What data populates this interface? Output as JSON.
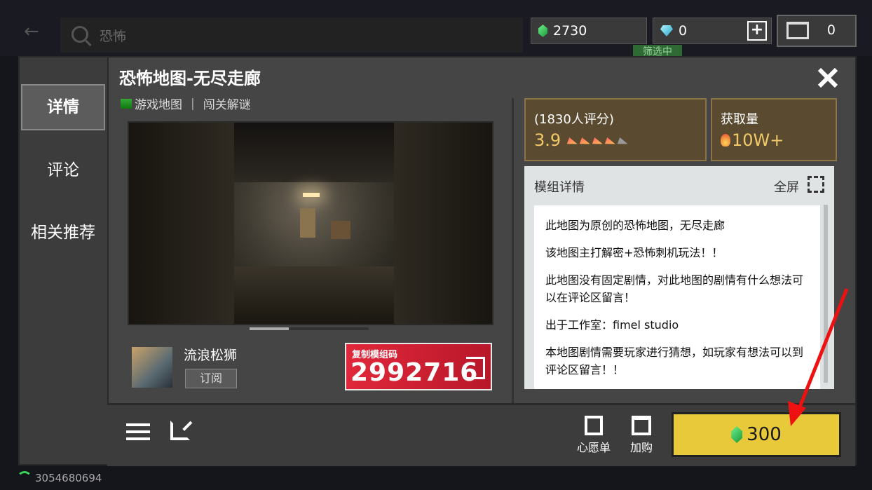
{
  "search": {
    "query": "恐怖"
  },
  "filter_label": "筛选中",
  "currency": {
    "emerald": "2730",
    "diamond": "0",
    "cart_count": "0"
  },
  "sidebar": {
    "items": [
      {
        "label": "详情"
      },
      {
        "label": "评论"
      },
      {
        "label": "相关推荐"
      }
    ]
  },
  "detail": {
    "title": "恐怖地图-无尽走廊",
    "tag1": "游戏地图",
    "tag2": "闯关解谜",
    "author": "流浪松狮",
    "subscribe": "订阅",
    "code_label": "复制模组码",
    "code": "2992716"
  },
  "stats": {
    "rating_label": "(1830人评分)",
    "rating_value": "3.9",
    "rating_stars": 3.9,
    "downloads_label": "获取量",
    "downloads_value": "10W+"
  },
  "description": {
    "heading": "模组详情",
    "fullscreen": "全屏",
    "paragraphs": [
      "此地图为原创的恐怖地图，无尽走廊",
      "该地图主打解密+恐怖刺机玩法！！",
      "此地图没有固定剧情，对此地图的剧情有什么想法可以在评论区留言！",
      "出于工作室：fimel studio",
      "本地图剧情需要玩家进行猜想，如玩家有想法可以到评论区留言！！"
    ]
  },
  "bottom": {
    "wishlist": "心愿单",
    "add_cart": "加购",
    "price": "300"
  },
  "user_id": "3054680694",
  "colors": {
    "accent_yellow": "#e8c93a",
    "annotation_red": "#ee1111",
    "emerald": "#1a9a3a"
  }
}
